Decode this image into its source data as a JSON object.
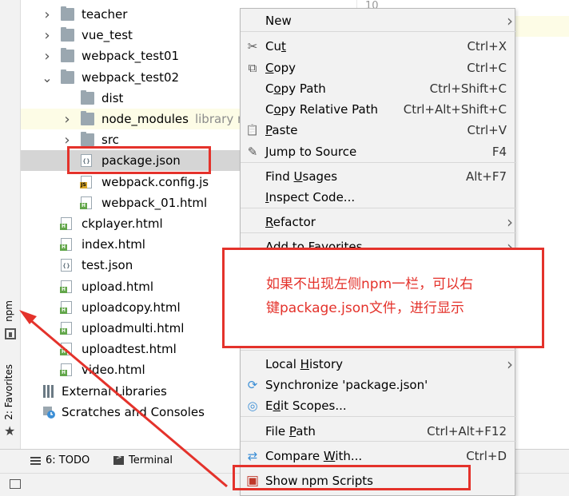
{
  "tree": {
    "items": [
      {
        "name": "teacher",
        "type": "folder",
        "expand": "collapsed",
        "indent": 0
      },
      {
        "name": "vue_test",
        "type": "folder",
        "expand": "collapsed",
        "indent": 0
      },
      {
        "name": "webpack_test01",
        "type": "folder",
        "expand": "collapsed",
        "indent": 0
      },
      {
        "name": "webpack_test02",
        "type": "folder",
        "expand": "expanded",
        "indent": 0
      },
      {
        "name": "dist",
        "type": "folder",
        "expand": "none",
        "indent": 1
      },
      {
        "name": "node_modules",
        "type": "folder",
        "expand": "collapsed",
        "indent": 1,
        "suffix": "library r",
        "highlight": true
      },
      {
        "name": "src",
        "type": "folder",
        "expand": "collapsed",
        "indent": 1
      },
      {
        "name": "package.json",
        "type": "json",
        "expand": "none",
        "indent": 1,
        "selected": true
      },
      {
        "name": "webpack.config.js",
        "type": "js",
        "expand": "none",
        "indent": 1
      },
      {
        "name": "webpack_01.html",
        "type": "html",
        "expand": "none",
        "indent": 1
      },
      {
        "name": "ckplayer.html",
        "type": "html",
        "expand": "none",
        "indent": 0
      },
      {
        "name": "index.html",
        "type": "html",
        "expand": "none",
        "indent": 0
      },
      {
        "name": "test.json",
        "type": "json",
        "expand": "none",
        "indent": 0
      },
      {
        "name": "upload.html",
        "type": "html",
        "expand": "none",
        "indent": 0
      },
      {
        "name": "uploadcopy.html",
        "type": "html",
        "expand": "none",
        "indent": 0
      },
      {
        "name": "uploadmulti.html",
        "type": "html",
        "expand": "none",
        "indent": 0
      },
      {
        "name": "uploadtest.html",
        "type": "html",
        "expand": "none",
        "indent": 0
      },
      {
        "name": "video.html",
        "type": "html",
        "expand": "none",
        "indent": 0
      }
    ],
    "external_libraries": "External Libraries",
    "scratches": "Scratches and Consoles"
  },
  "left_strip": {
    "npm_tab": "npm",
    "favorites_tab": "2: Favorites"
  },
  "editor": {
    "line_number": "10"
  },
  "bottom_tabs": {
    "todo": "6: TODO",
    "terminal": "Terminal"
  },
  "menu": {
    "items": [
      {
        "label": "New",
        "shortcut": "",
        "submenu": true,
        "icon": "",
        "top": 0
      },
      {
        "label": "Cut",
        "shortcut": "Ctrl+X",
        "icon": "scissors-icon"
      },
      {
        "label": "Copy",
        "shortcut": "Ctrl+C",
        "icon": "copy-icon"
      },
      {
        "label": "Copy Path",
        "shortcut": "Ctrl+Shift+C",
        "icon": ""
      },
      {
        "label": "Copy Relative Path",
        "shortcut": "Ctrl+Alt+Shift+C",
        "icon": ""
      },
      {
        "label": "Paste",
        "shortcut": "Ctrl+V",
        "icon": "paste-icon"
      },
      {
        "label": "Jump to Source",
        "shortcut": "F4",
        "icon": "pencil-icon"
      },
      {
        "label": "Find Usages",
        "shortcut": "Alt+F7",
        "icon": ""
      },
      {
        "label": "Inspect Code...",
        "shortcut": "",
        "icon": ""
      },
      {
        "label": "Refactor",
        "shortcut": "",
        "submenu": true,
        "icon": ""
      },
      {
        "label": "Add to Favorites",
        "shortcut": "",
        "submenu": true,
        "icon": ""
      },
      {
        "label": "Local History",
        "shortcut": "",
        "submenu": true,
        "icon": ""
      },
      {
        "label": "Synchronize 'package.json'",
        "shortcut": "",
        "icon": "sync-icon"
      },
      {
        "label": "Edit Scopes...",
        "shortcut": "",
        "icon": "scope-icon"
      },
      {
        "label": "File Path",
        "shortcut": "Ctrl+Alt+F12",
        "icon": ""
      },
      {
        "label": "Compare With...",
        "shortcut": "Ctrl+D",
        "icon": "compare-icon"
      },
      {
        "label": "Show npm Scripts",
        "shortcut": "",
        "icon": "npm-icon"
      }
    ]
  },
  "annotation": {
    "text_line1": "如果不出现左侧npm一栏，可以右",
    "text_line2": "键package.json文件，进行显示"
  },
  "colors": {
    "annotation": "#e4322b",
    "menu_bg": "#f2f2f2",
    "selected_row": "#d5d5d5",
    "html_tag": "#62a64a",
    "js_tag": "#d9a72b"
  }
}
